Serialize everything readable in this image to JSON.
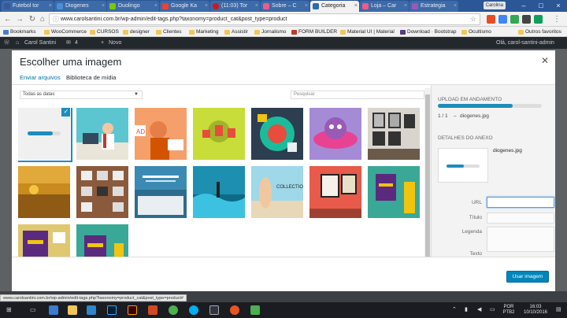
{
  "browser": {
    "tabs": [
      {
        "label": "Futebol tor",
        "fav": "#3b5998"
      },
      {
        "label": "Diogenes",
        "fav": "#4a90d9"
      },
      {
        "label": "Duolingo",
        "fav": "#7ac70c"
      },
      {
        "label": "Google Ka",
        "fav": "#ea4335"
      },
      {
        "label": "(11:03) Tor",
        "fav": "#cc181e"
      },
      {
        "label": "Sobre – C",
        "fav": "#e95d8a"
      },
      {
        "label": "Categoria",
        "fav": "#2b6cb0",
        "active": true
      },
      {
        "label": "Loja – Car",
        "fav": "#e95d8a"
      },
      {
        "label": "Estrategia",
        "fav": "#9b59b6"
      }
    ],
    "profile": "Carolina",
    "address": "www.carolsantini.com.br/wp-admin/edit-tags.php?taxonomy=product_cat&post_type=product",
    "bookmarks": [
      "Bookmarks",
      "WooCommerce",
      "CURSOS",
      "designer",
      "Clientes",
      "Marketing",
      "Assistir",
      "Jornalismo",
      "FORM BUILDER",
      "Material UI | Material",
      "Download · Bootstrap",
      "Ocultismo",
      "Outros favoritos"
    ],
    "status_url": "www.carolsantini.com.br/wp-admin/edit-tags.php?taxonomy=product_cat&post_type=product#"
  },
  "wpbar": {
    "site": "Carol Santini",
    "comments": "4",
    "new": "Novo",
    "greeting": "Olá, carol-santini-admin"
  },
  "modal": {
    "title": "Escolher uma imagem",
    "tabs": [
      "Enviar arquivos",
      "Biblioteca de mídia"
    ],
    "filter": "Todas as datas",
    "search_placeholder": "Pesquisar",
    "sidebar": {
      "upload_heading": "UPLOAD EM ANDAMENTO",
      "upload_progress": 0.72,
      "upload_count": "1 / 1",
      "upload_sep": "–",
      "upload_file": "diogenes.jpg",
      "details_heading": "DETALHES DO ANEXO",
      "details_file": "diogenes.jpg",
      "fields": [
        "URL",
        "Título",
        "Legenda",
        "Texto"
      ]
    },
    "use_button": "Usar imagem"
  },
  "taskbar": {
    "lang": "POR",
    "layout": "PTB2",
    "time": "16:03",
    "date": "10/10/2016"
  }
}
